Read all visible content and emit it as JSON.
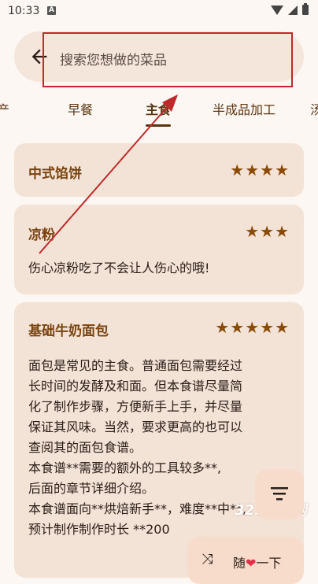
{
  "status_bar": {
    "time": "10:33",
    "notification_icon": "A"
  },
  "search": {
    "placeholder": "搜索您想做的菜品"
  },
  "tabs": [
    {
      "label": "产"
    },
    {
      "label": "早餐"
    },
    {
      "label": "主食"
    },
    {
      "label": "半成品加工"
    },
    {
      "label": "汤"
    }
  ],
  "active_tab": "主食",
  "recipes": [
    {
      "title": "中式馅饼",
      "stars": "★★★★",
      "rating": 4,
      "description": ""
    },
    {
      "title": "凉粉",
      "stars": "★★★",
      "rating": 3,
      "description": "伤心凉粉吃了不会让人伤心的哦!"
    },
    {
      "title": "基础牛奶面包",
      "stars": "★★★★★",
      "rating": 5,
      "description": "面包是常见的主食。普通面包需要经过\n长时间的发酵及和面。但本食谱尽量简\n化了制作步骤，方便新手上手，并尽量\n保证其风味。当然，要求更高的也可以\n查阅其的面包食谱。\n本食谱**需要的额外的工具较多**,\n后面的章节详细介绍。\n本食谱面向**烘焙新手**，难度**中**,\n预计制作制作时长 **200"
    }
  ],
  "fab": {
    "random_label_prefix": "随",
    "random_label_suffix": "一下"
  },
  "watermark": "321手游网",
  "colors": {
    "accent": "#5a3410",
    "annotation": "#c0282a",
    "card": "#f3e3d7"
  }
}
